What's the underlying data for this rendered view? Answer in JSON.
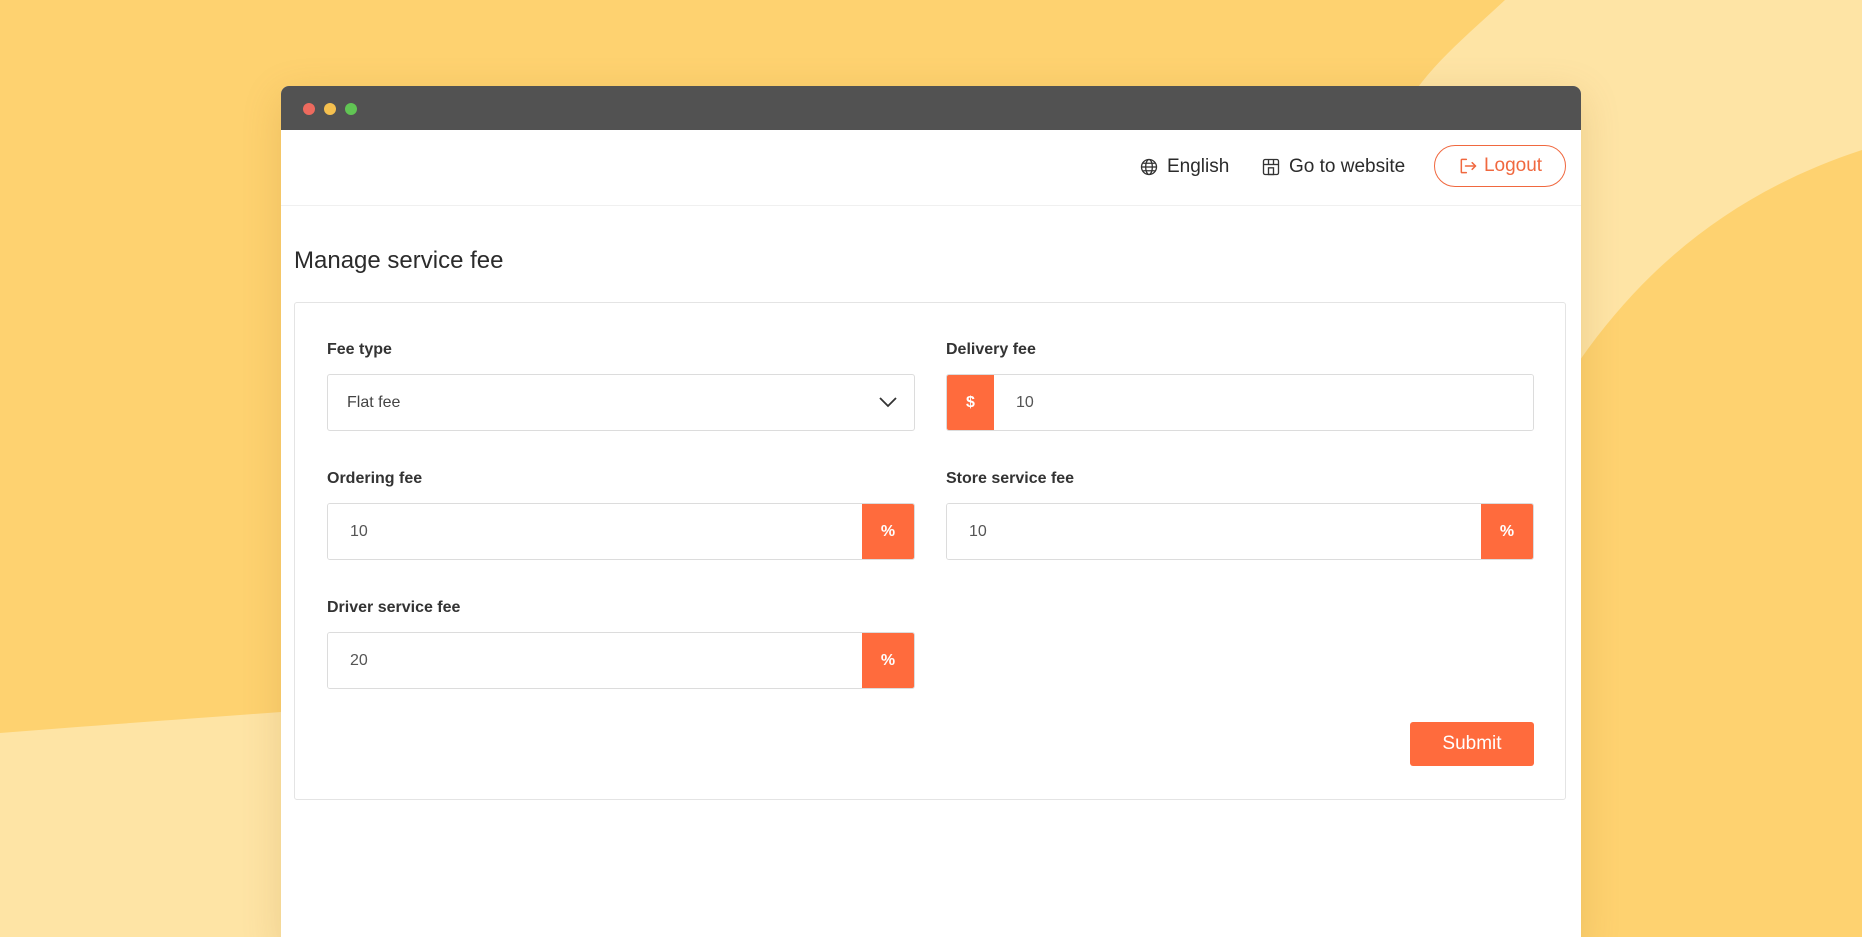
{
  "nav": {
    "language": "English",
    "website": "Go to website",
    "logout": "Logout"
  },
  "page": {
    "title": "Manage service fee"
  },
  "form": {
    "fee_type": {
      "label": "Fee type",
      "value": "Flat fee"
    },
    "delivery_fee": {
      "label": "Delivery fee",
      "prefix": "$",
      "value": "10"
    },
    "ordering_fee": {
      "label": "Ordering fee",
      "value": "10",
      "suffix": "%"
    },
    "store_service_fee": {
      "label": "Store service fee",
      "value": "10",
      "suffix": "%"
    },
    "driver_service_fee": {
      "label": "Driver service fee",
      "value": "20",
      "suffix": "%"
    },
    "submit": "Submit"
  },
  "colors": {
    "accent": "#ff6b3d",
    "background": "#fed270",
    "titlebar": "#525252"
  }
}
